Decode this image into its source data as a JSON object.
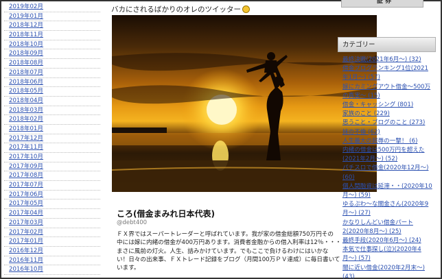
{
  "archive": {
    "items": [
      "2019年02月",
      "2019年01月",
      "2018年12月",
      "2018年11月",
      "2018年10月",
      "2018年09月",
      "2018年08月",
      "2018年07月",
      "2018年06月",
      "2018年05月",
      "2018年04月",
      "2018年03月",
      "2018年02月",
      "2018年01月",
      "2017年12月",
      "2017年11月",
      "2017年10月",
      "2017年09月",
      "2017年08月",
      "2017年07月",
      "2017年06月",
      "2017年05月",
      "2017年04月",
      "2017年03月",
      "2017年02月",
      "2017年01月",
      "2016年12月",
      "2016年11月",
      "2016年10月"
    ]
  },
  "tweet": {
    "title": "バカにされるばかりのオレのツイッター",
    "profile_name": "ころ(借金まみれ日本代表)",
    "handle": "@debt400",
    "bio_lines": [
      "ＦＸ界ではスーパートレーダーと呼ばれています。我が家の借金総額750万円その",
      "中には嫁に内緒の借金が400万円あります。消費者金融からの借入利率は12％・・・",
      "まさに風前の灯火。人生、詰みかけています。でもここで負けるわけにはいかな",
      "い！日々の出来事、ＦＸトレード記録をブログ（月間100万ＰＶ達成）に毎日書いて",
      "います。"
    ]
  },
  "sidebar": {
    "top_label": "証 券",
    "category_heading": "カテゴリー",
    "categories": [
      "最終決戦(2021年6月〜) (32)",
      "借金ブログランキング1位(2021年1月〜) (57)",
      "嫁にカミングアウト借金〜500万の真実〜 (15)",
      "借金・キャッシング (801)",
      "家族のこと (229)",
      "思うこと・ブログのこと (273)",
      "妹の不倫 (62)",
      "人生最大の屈辱の一撃！ (6)",
      "内緒の借金は500万円を超えた(2021年2月〜) (52)",
      "パチスロで借金(2020年12月〜) (60)",
      "個人間融資は延滞・・(2020年10月〜) (59)",
      "ゆるぷわ〜な闇金さん(2020年9月〜) (27)",
      "かなりしんどい借金パート2(2020年8月〜) (25)",
      "最終手段(2020年6月〜) (24)",
      "本気で仕事探し(泣)(2020年4月〜) (57)",
      "闇に近い借金(2020年2月末〜) (43)"
    ]
  }
}
